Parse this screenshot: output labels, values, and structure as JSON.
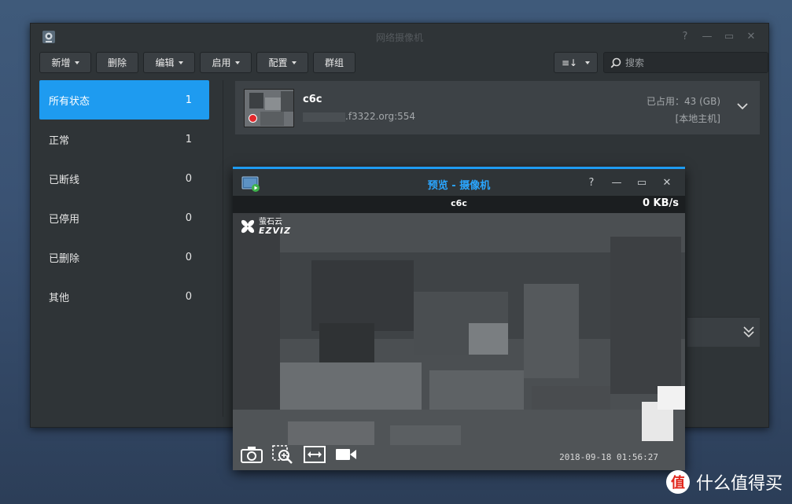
{
  "main_window": {
    "title": "网络摄像机",
    "controls": {
      "help": "?",
      "minimize": "—",
      "maximize": "▭",
      "close": "✕"
    }
  },
  "toolbar": {
    "add_label": "新增",
    "delete_label": "删除",
    "edit_label": "编辑",
    "enable_label": "启用",
    "config_label": "配置",
    "group_label": "群组",
    "sort_label": "≡↓",
    "search_placeholder": "搜索"
  },
  "sidebar": {
    "items": [
      {
        "label": "所有状态",
        "count": "1"
      },
      {
        "label": "正常",
        "count": "1"
      },
      {
        "label": "已断线",
        "count": "0"
      },
      {
        "label": "已停用",
        "count": "0"
      },
      {
        "label": "已删除",
        "count": "0"
      },
      {
        "label": "其他",
        "count": "0"
      }
    ]
  },
  "camera_list": [
    {
      "name": "c6c",
      "address": ".f3322.org:554",
      "usage": "已占用：43 (GB)",
      "server": "[本地主机]"
    }
  ],
  "preview_window": {
    "title": "预览 - 摄像机",
    "controls": {
      "help": "?",
      "minimize": "—",
      "maximize": "▭",
      "close": "✕"
    },
    "camera_name": "c6c",
    "bitrate": "0 KB/s",
    "brand_cn": "萤石云",
    "brand_en": "EZVIZ",
    "timestamp": "2018-09-18 01:56:27"
  },
  "watermark": {
    "logo": "值",
    "text": "什么值得买"
  },
  "colors": {
    "accent": "#1e9bf0",
    "recording": "#e2282c",
    "window_bg": "#2f3437"
  }
}
